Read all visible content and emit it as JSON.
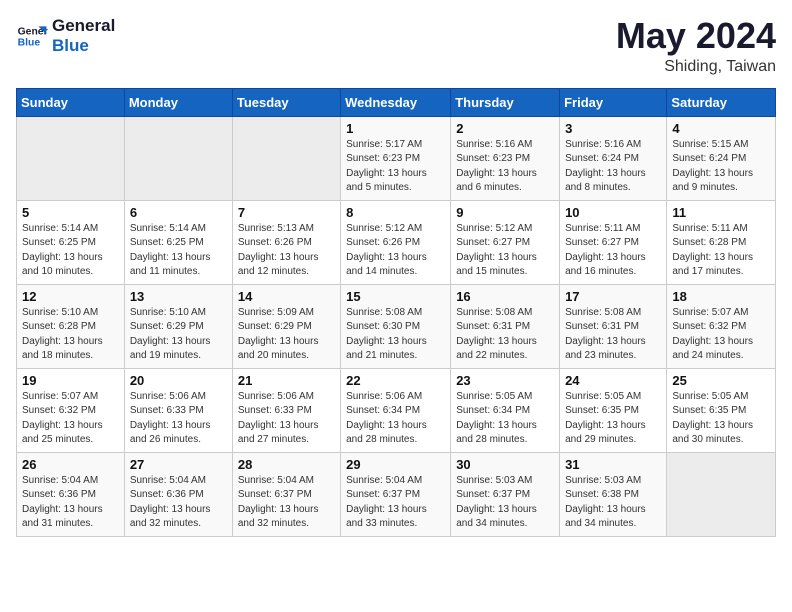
{
  "header": {
    "logo_line1": "General",
    "logo_line2": "Blue",
    "month_title": "May 2024",
    "location": "Shiding, Taiwan"
  },
  "weekdays": [
    "Sunday",
    "Monday",
    "Tuesday",
    "Wednesday",
    "Thursday",
    "Friday",
    "Saturday"
  ],
  "weeks": [
    [
      {
        "day": "",
        "info": ""
      },
      {
        "day": "",
        "info": ""
      },
      {
        "day": "",
        "info": ""
      },
      {
        "day": "1",
        "info": "Sunrise: 5:17 AM\nSunset: 6:23 PM\nDaylight: 13 hours\nand 5 minutes."
      },
      {
        "day": "2",
        "info": "Sunrise: 5:16 AM\nSunset: 6:23 PM\nDaylight: 13 hours\nand 6 minutes."
      },
      {
        "day": "3",
        "info": "Sunrise: 5:16 AM\nSunset: 6:24 PM\nDaylight: 13 hours\nand 8 minutes."
      },
      {
        "day": "4",
        "info": "Sunrise: 5:15 AM\nSunset: 6:24 PM\nDaylight: 13 hours\nand 9 minutes."
      }
    ],
    [
      {
        "day": "5",
        "info": "Sunrise: 5:14 AM\nSunset: 6:25 PM\nDaylight: 13 hours\nand 10 minutes."
      },
      {
        "day": "6",
        "info": "Sunrise: 5:14 AM\nSunset: 6:25 PM\nDaylight: 13 hours\nand 11 minutes."
      },
      {
        "day": "7",
        "info": "Sunrise: 5:13 AM\nSunset: 6:26 PM\nDaylight: 13 hours\nand 12 minutes."
      },
      {
        "day": "8",
        "info": "Sunrise: 5:12 AM\nSunset: 6:26 PM\nDaylight: 13 hours\nand 14 minutes."
      },
      {
        "day": "9",
        "info": "Sunrise: 5:12 AM\nSunset: 6:27 PM\nDaylight: 13 hours\nand 15 minutes."
      },
      {
        "day": "10",
        "info": "Sunrise: 5:11 AM\nSunset: 6:27 PM\nDaylight: 13 hours\nand 16 minutes."
      },
      {
        "day": "11",
        "info": "Sunrise: 5:11 AM\nSunset: 6:28 PM\nDaylight: 13 hours\nand 17 minutes."
      }
    ],
    [
      {
        "day": "12",
        "info": "Sunrise: 5:10 AM\nSunset: 6:28 PM\nDaylight: 13 hours\nand 18 minutes."
      },
      {
        "day": "13",
        "info": "Sunrise: 5:10 AM\nSunset: 6:29 PM\nDaylight: 13 hours\nand 19 minutes."
      },
      {
        "day": "14",
        "info": "Sunrise: 5:09 AM\nSunset: 6:29 PM\nDaylight: 13 hours\nand 20 minutes."
      },
      {
        "day": "15",
        "info": "Sunrise: 5:08 AM\nSunset: 6:30 PM\nDaylight: 13 hours\nand 21 minutes."
      },
      {
        "day": "16",
        "info": "Sunrise: 5:08 AM\nSunset: 6:31 PM\nDaylight: 13 hours\nand 22 minutes."
      },
      {
        "day": "17",
        "info": "Sunrise: 5:08 AM\nSunset: 6:31 PM\nDaylight: 13 hours\nand 23 minutes."
      },
      {
        "day": "18",
        "info": "Sunrise: 5:07 AM\nSunset: 6:32 PM\nDaylight: 13 hours\nand 24 minutes."
      }
    ],
    [
      {
        "day": "19",
        "info": "Sunrise: 5:07 AM\nSunset: 6:32 PM\nDaylight: 13 hours\nand 25 minutes."
      },
      {
        "day": "20",
        "info": "Sunrise: 5:06 AM\nSunset: 6:33 PM\nDaylight: 13 hours\nand 26 minutes."
      },
      {
        "day": "21",
        "info": "Sunrise: 5:06 AM\nSunset: 6:33 PM\nDaylight: 13 hours\nand 27 minutes."
      },
      {
        "day": "22",
        "info": "Sunrise: 5:06 AM\nSunset: 6:34 PM\nDaylight: 13 hours\nand 28 minutes."
      },
      {
        "day": "23",
        "info": "Sunrise: 5:05 AM\nSunset: 6:34 PM\nDaylight: 13 hours\nand 28 minutes."
      },
      {
        "day": "24",
        "info": "Sunrise: 5:05 AM\nSunset: 6:35 PM\nDaylight: 13 hours\nand 29 minutes."
      },
      {
        "day": "25",
        "info": "Sunrise: 5:05 AM\nSunset: 6:35 PM\nDaylight: 13 hours\nand 30 minutes."
      }
    ],
    [
      {
        "day": "26",
        "info": "Sunrise: 5:04 AM\nSunset: 6:36 PM\nDaylight: 13 hours\nand 31 minutes."
      },
      {
        "day": "27",
        "info": "Sunrise: 5:04 AM\nSunset: 6:36 PM\nDaylight: 13 hours\nand 32 minutes."
      },
      {
        "day": "28",
        "info": "Sunrise: 5:04 AM\nSunset: 6:37 PM\nDaylight: 13 hours\nand 32 minutes."
      },
      {
        "day": "29",
        "info": "Sunrise: 5:04 AM\nSunset: 6:37 PM\nDaylight: 13 hours\nand 33 minutes."
      },
      {
        "day": "30",
        "info": "Sunrise: 5:03 AM\nSunset: 6:37 PM\nDaylight: 13 hours\nand 34 minutes."
      },
      {
        "day": "31",
        "info": "Sunrise: 5:03 AM\nSunset: 6:38 PM\nDaylight: 13 hours\nand 34 minutes."
      },
      {
        "day": "",
        "info": ""
      }
    ]
  ]
}
